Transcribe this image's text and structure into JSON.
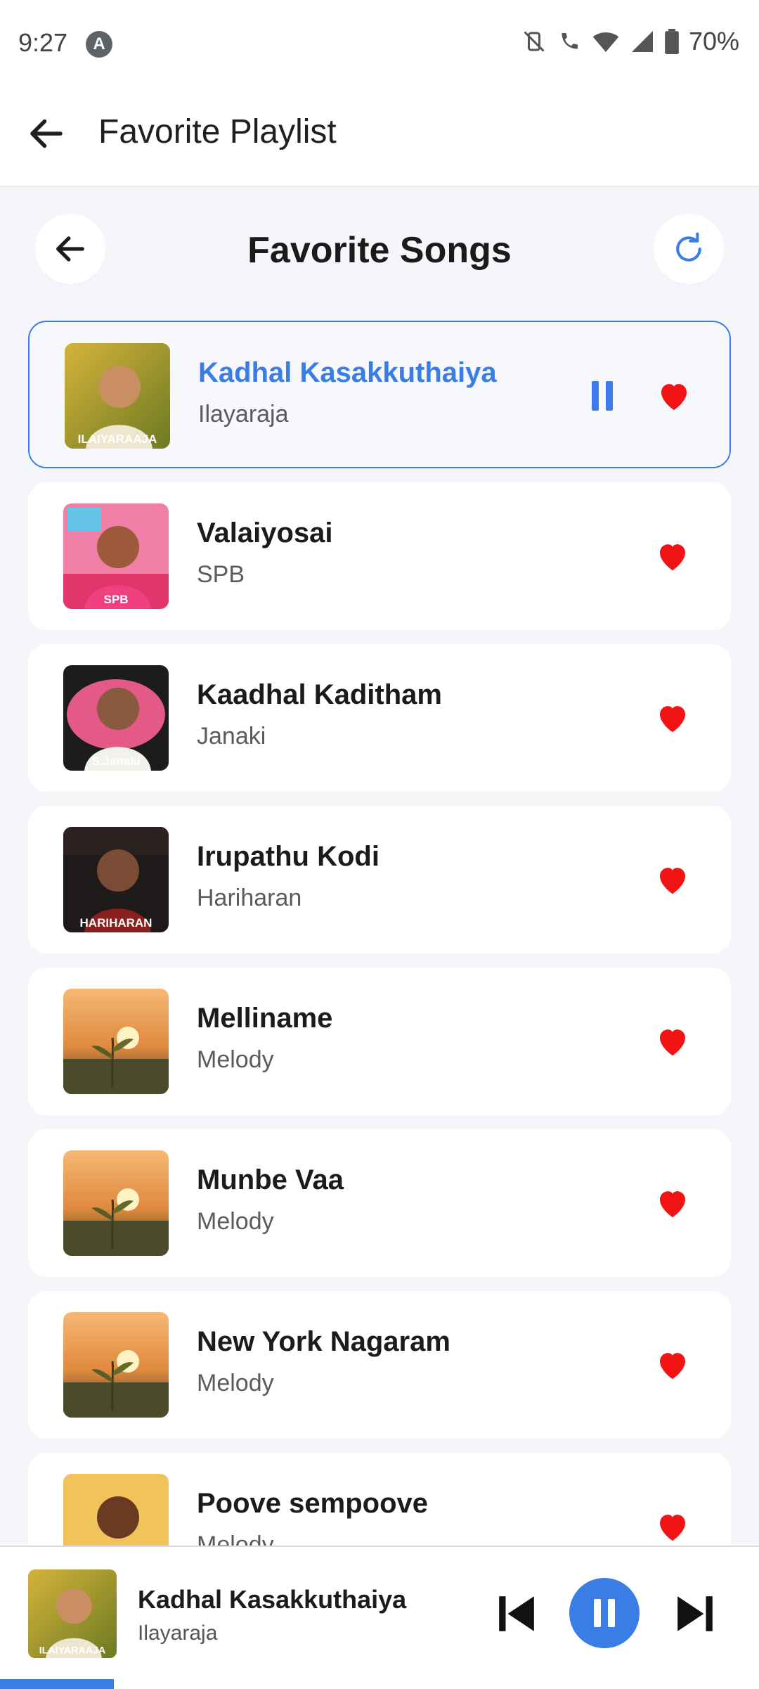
{
  "status": {
    "time": "9:27",
    "launcher_glyph": "A",
    "battery": "70%"
  },
  "appbar": {
    "title": "Favorite Playlist"
  },
  "page": {
    "heading": "Favorite Songs"
  },
  "songs": [
    {
      "title": "Kadhal Kasakkuthaiya",
      "artist": "Ilayaraja",
      "thumb": "portrait-yellow",
      "caption": "ILAIYARAAJA"
    },
    {
      "title": "Valaiyosai",
      "artist": "SPB",
      "thumb": "portrait-pink",
      "caption": "SPB"
    },
    {
      "title": "Kaadhal Kaditham",
      "artist": "Janaki",
      "thumb": "portrait-rose",
      "caption": "S.Janaki"
    },
    {
      "title": "Irupathu Kodi",
      "artist": "Hariharan",
      "thumb": "portrait-dark",
      "caption": "HARIHARAN"
    },
    {
      "title": "Melliname",
      "artist": "Melody",
      "thumb": "sunset"
    },
    {
      "title": "Munbe Vaa",
      "artist": "Melody",
      "thumb": "sunset"
    },
    {
      "title": "New York Nagaram",
      "artist": "Melody",
      "thumb": "sunset"
    },
    {
      "title": "Poove sempoove",
      "artist": "Melody",
      "thumb": "portrait-warm"
    }
  ],
  "player": {
    "title": "Kadhal Kasakkuthaiya",
    "artist": "Ilayaraja",
    "caption": "ILAIYARAAJA",
    "progress": 0.15
  },
  "colors": {
    "accent": "#3b7de6",
    "heart": "#f21414",
    "background": "#f4f6fa"
  },
  "icons": {
    "back": "arrow-left-icon",
    "refresh": "refresh-icon",
    "favorite": "heart-icon",
    "pause": "pause-icon",
    "previous": "skip-previous-icon",
    "next": "skip-next-icon"
  }
}
